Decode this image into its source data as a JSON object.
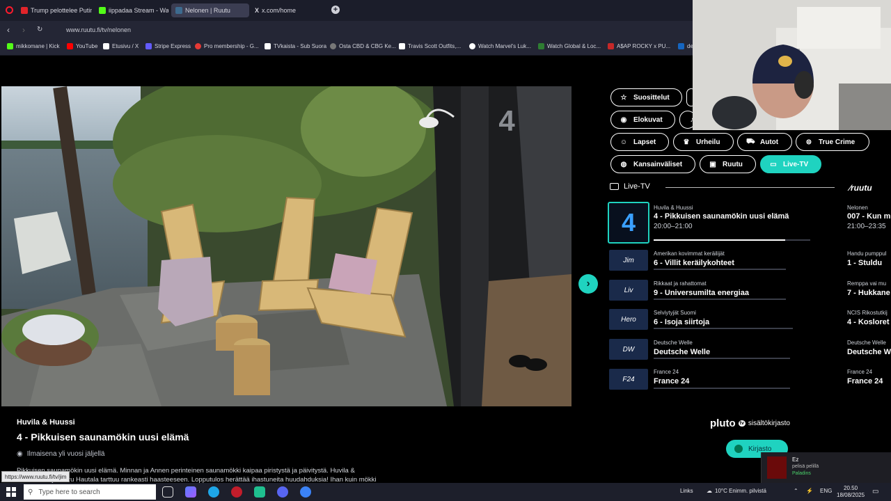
{
  "browser": {
    "tabs": [
      {
        "label": "Trump pelottelee Putinia"
      },
      {
        "label": "iippadaa Stream - Watch"
      },
      {
        "label": "Nelonen | Ruutu"
      },
      {
        "label": "x.com/home"
      }
    ],
    "new_tab": "+",
    "url": "www.ruutu.fi/tv/nelonen",
    "bookmarks": [
      {
        "label": "mikkomane | Kick",
        "color": "#53fc18"
      },
      {
        "label": "YouTube",
        "color": "#ff0000"
      },
      {
        "label": "Etusivu / X",
        "color": "#ffffff"
      },
      {
        "label": "Stripe Express",
        "color": "#635bff"
      },
      {
        "label": "Pro membership - G...",
        "color": "#e53935"
      },
      {
        "label": "TVkaista - Sub Suora",
        "color": "#ffffff"
      },
      {
        "label": "Osta CBD & CBG Ke...",
        "color": "#777777"
      },
      {
        "label": "Travis Scott Outfits,...",
        "color": "#ffffff"
      },
      {
        "label": "Watch Marvel's Luk...",
        "color": "#ffffff"
      },
      {
        "label": "Watch Global & Loc...",
        "color": "#2e7d32"
      },
      {
        "label": "A$AP ROCKY x PU...",
        "color": "#c62828"
      },
      {
        "label": "de",
        "color": "#1565c0"
      }
    ]
  },
  "player": {
    "channel_watermark": "4"
  },
  "categories": [
    {
      "label": "Suosittelut",
      "icon": "star-icon"
    },
    {
      "label": "Elokuvat",
      "icon": "film-icon"
    },
    {
      "label": "Lapset",
      "icon": "kids-icon"
    },
    {
      "label": "Urheilu",
      "icon": "trophy-icon"
    },
    {
      "label": "Autot",
      "icon": "car-icon"
    },
    {
      "label": "True Crime",
      "icon": "crime-icon"
    },
    {
      "label": "Kansainväliset",
      "icon": "globe-icon"
    },
    {
      "label": "Ruutu",
      "icon": "ruutu-icon"
    },
    {
      "label": "Live-TV",
      "icon": "tv-icon",
      "active": true
    }
  ],
  "live": {
    "heading": "Live-TV",
    "brand": "ruutu",
    "rows": [
      {
        "logo": "4",
        "sub": "Huvila & Huussi",
        "title": "4 - Pikkuisen saunamökin uusi elämä",
        "time": "20:00–21:00",
        "progress": 0.84,
        "next_sub": "Nelonen",
        "next_title": "007 - Kun m",
        "next_time": "21:00–23:35"
      },
      {
        "logo": "Jim",
        "sub": "Amerikan kovimmat keräilijät",
        "title": "6 - Villit keräilykohteet",
        "progress": 0,
        "next_sub": "Handu pumppul",
        "next_title": "1 - Stuldu"
      },
      {
        "logo": "Liv",
        "sub": "Rikkaat ja rahattomat",
        "title": "9 - Universumilta energiaa",
        "progress": 0,
        "next_sub": "Remppa vai mu",
        "next_title": "7 - Hukkane"
      },
      {
        "logo": "Hero",
        "sub": "Selviytyjät Suomi",
        "title": "6 - Isoja siirtoja",
        "progress": 0,
        "next_sub": "NCIS Rikostutkij",
        "next_title": "4 - Kosloret"
      },
      {
        "logo": "DW",
        "sub": "Deutsche Welle",
        "title": "Deutsche Welle",
        "progress": 0,
        "next_sub": "Deutsche Welle",
        "next_title": "Deutsche We"
      },
      {
        "logo": "F24",
        "sub": "France 24",
        "title": "France 24",
        "progress": 0,
        "next_sub": "France 24",
        "next_title": "France 24"
      }
    ]
  },
  "info": {
    "channel": "Huvila & Huussi",
    "title": "4 - Pikkuisen saunamökin uusi elämä",
    "availability": "Ilmaisena yli vuosi jäljellä",
    "desc_line1": "Pikkuisen saunamökin uusi elämä. Minnan ja Annen perinteinen saunamökki kaipaa piristystä ja päivitystä. Huvila &",
    "desc_line2": "...suunnittelija Maru Hautala tarttuu rankeasti haasteeseen. Lopputulos herättää ihastuneita huudahduksia! Ihan kuin mökki",
    "status_url": "https://www.ruutu.fi/tv/jim"
  },
  "pluto": {
    "brand": "pluto",
    "badge": "tv",
    "label": "sisältökirjasto",
    "button": "Kirjasto"
  },
  "toast": {
    "name": "Ez",
    "line2": "pelisä pelillä",
    "line3": "Paladins"
  },
  "taskbar": {
    "search_placeholder": "Type here to search",
    "links": "Links",
    "weather": "10°C  Enimm. pilvistä",
    "lang": "ENG",
    "time": "20.50",
    "date": "18/08/2025"
  }
}
